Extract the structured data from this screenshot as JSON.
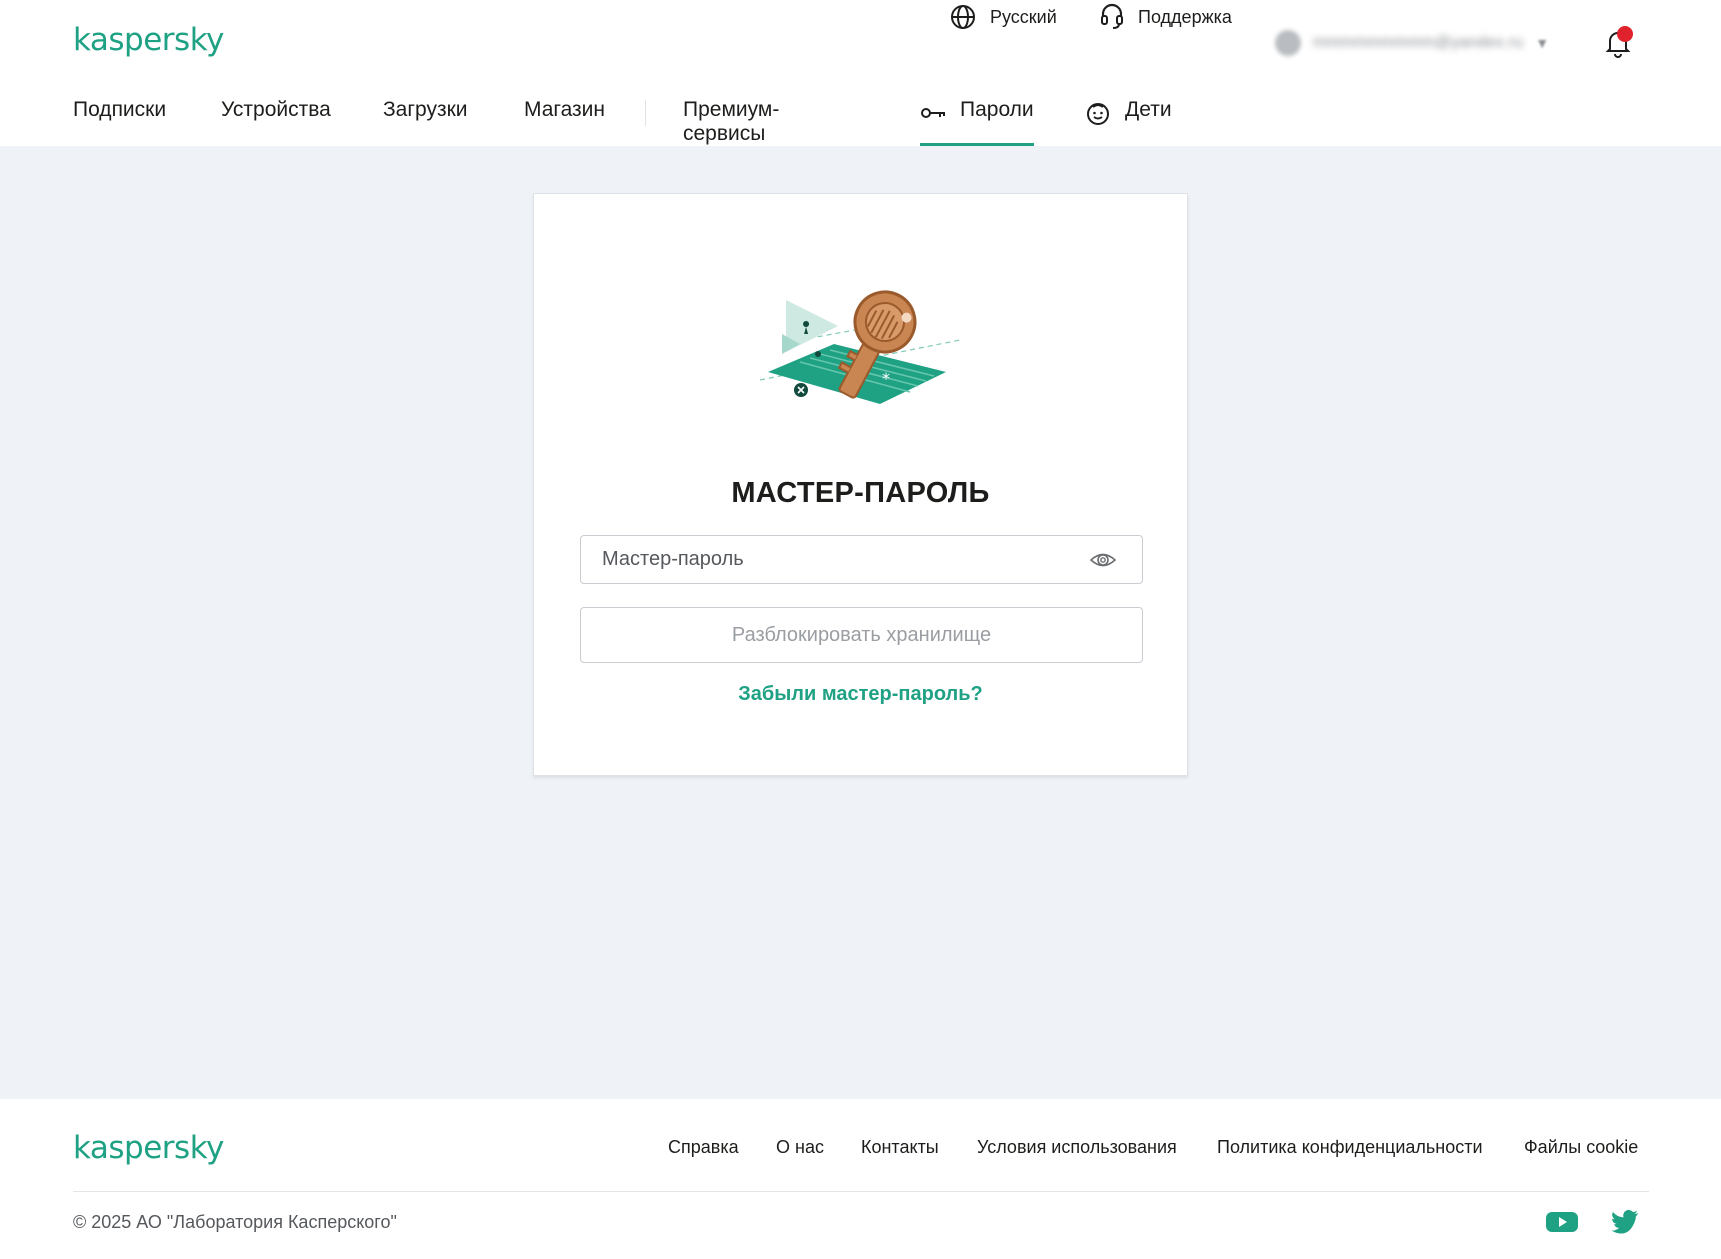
{
  "brand": {
    "logo": "kaspersky",
    "color": "#1fa184"
  },
  "header": {
    "language": {
      "label": "Русский",
      "icon": "globe-icon"
    },
    "support": {
      "label": "Поддержка",
      "icon": "headset-icon"
    },
    "user": {
      "email": "mmmmmmmmm@yandex.ru",
      "icon": "avatar-icon"
    },
    "notifications": {
      "icon": "bell-icon",
      "badge_color": "#e0222d"
    }
  },
  "nav": {
    "items": [
      {
        "label": "Подписки"
      },
      {
        "label": "Устройства"
      },
      {
        "label": "Загрузки"
      },
      {
        "label": "Магазин"
      },
      {
        "label": "Премиум-сервисы"
      },
      {
        "label": "Пароли",
        "icon": "key-icon",
        "active": true
      },
      {
        "label": "Дети",
        "icon": "child-face-icon"
      }
    ]
  },
  "card": {
    "illustration": "key-on-keyboard-illustration",
    "title": "МАСТЕР-ПАРОЛЬ",
    "password_placeholder": "Мастер-пароль",
    "password_value": "",
    "eye_icon": "eye-icon",
    "unlock_label": "Разблокировать хранилище",
    "forgot_label": "Забыли мастер-пароль?"
  },
  "footer": {
    "logo": "kaspersky",
    "links": [
      "Справка",
      "О нас",
      "Контакты",
      "Условия использования",
      "Политика конфиденциальности",
      "Файлы cookie"
    ],
    "copyright": "© 2025 АО \"Лаборатория Касперского\"",
    "social": [
      "youtube-icon",
      "twitter-icon"
    ]
  }
}
